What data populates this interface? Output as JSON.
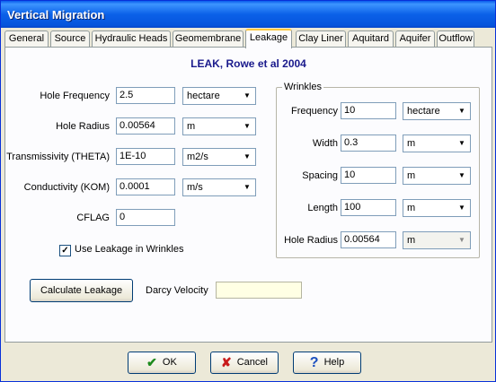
{
  "window": {
    "title": "Vertical Migration"
  },
  "tabs": [
    {
      "label": "General"
    },
    {
      "label": "Source"
    },
    {
      "label": "Hydraulic Heads"
    },
    {
      "label": "Geomembrane"
    },
    {
      "label": "Leakage",
      "active": true
    },
    {
      "label": "Clay Liner"
    },
    {
      "label": "Aquitard"
    },
    {
      "label": "Aquifer"
    },
    {
      "label": "Outflow"
    }
  ],
  "heading": "LEAK, Rowe et al 2004",
  "left_fields": {
    "hole_frequency": {
      "label": "Hole Frequency",
      "value": "2.5",
      "unit": "hectare"
    },
    "hole_radius": {
      "label": "Hole Radius",
      "value": "0.00564",
      "unit": "m"
    },
    "transmissivity": {
      "label": "Transmissivity (THETA)",
      "value": "1E-10",
      "unit": "m2/s"
    },
    "conductivity": {
      "label": "Conductivity (KOM)",
      "value": "0.0001",
      "unit": "m/s"
    },
    "cflag": {
      "label": "CFLAG",
      "value": "0"
    }
  },
  "use_leakage": {
    "label": "Use Leakage in Wrinkles",
    "checked": true,
    "mark": "✓"
  },
  "wrinkles": {
    "legend": "Wrinkles",
    "frequency": {
      "label": "Frequency",
      "value": "10",
      "unit": "hectare"
    },
    "width": {
      "label": "Width",
      "value": "0.3",
      "unit": "m"
    },
    "spacing": {
      "label": "Spacing",
      "value": "10",
      "unit": "m"
    },
    "length": {
      "label": "Length",
      "value": "100",
      "unit": "m"
    },
    "hole_radius": {
      "label": "Hole Radius",
      "value": "0.00564",
      "unit": "m"
    }
  },
  "calculate_button": "Calculate Leakage",
  "darcy": {
    "label": "Darcy Velocity",
    "value": ""
  },
  "buttons": {
    "ok": {
      "label": "OK",
      "icon": "✔"
    },
    "cancel": {
      "label": "Cancel",
      "icon": "✘"
    },
    "help": {
      "label": "Help",
      "icon": "?"
    }
  },
  "icons": {
    "dropdown": "▼"
  },
  "colors": {
    "title_bar": "#0a5dec",
    "heading": "#1a1a8c",
    "active_tab_accent": "#ffc83c",
    "darcy_field_bg": "#ffffe4"
  }
}
